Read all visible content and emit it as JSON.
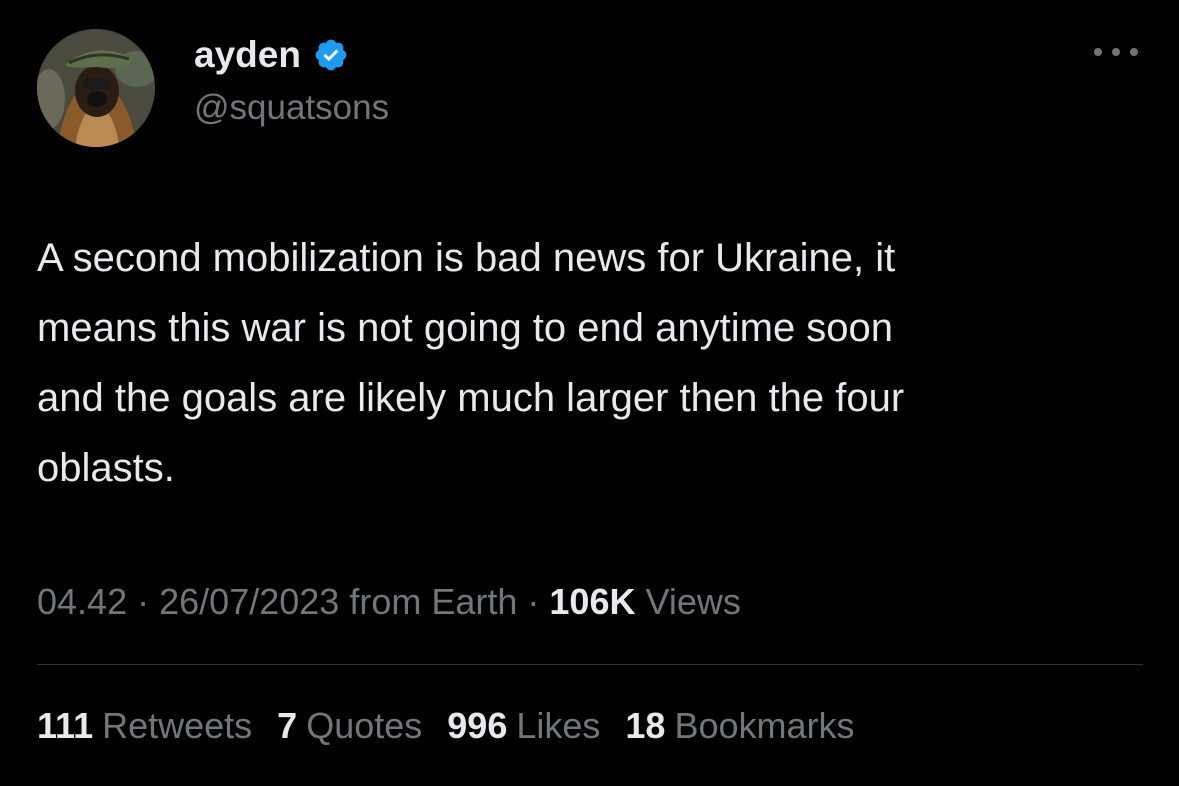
{
  "author": {
    "display_name": "ayden",
    "handle": "@squatsons",
    "verified": true,
    "verified_color": "#1d9bf0"
  },
  "more_icon": "more-horizontal-icon",
  "tweet": {
    "text_lines": [
      "A second mobilization is bad news for Ukraine, it",
      "means this war is not going to end anytime soon",
      "and the goals are likely much larger then the four",
      "oblasts."
    ]
  },
  "meta": {
    "time": "04.42",
    "separator": "·",
    "date": "26/07/2023",
    "source": "from Earth",
    "views_count": "106K",
    "views_label": "Views"
  },
  "stats": {
    "retweets": {
      "count": "111",
      "label": "Retweets"
    },
    "quotes": {
      "count": "7",
      "label": "Quotes"
    },
    "likes": {
      "count": "996",
      "label": "Likes"
    },
    "bookmarks": {
      "count": "18",
      "label": "Bookmarks"
    }
  },
  "colors": {
    "background": "#000000",
    "primary_text": "#e7e9ea",
    "secondary_text": "#71767b",
    "divider": "#2f3336"
  }
}
